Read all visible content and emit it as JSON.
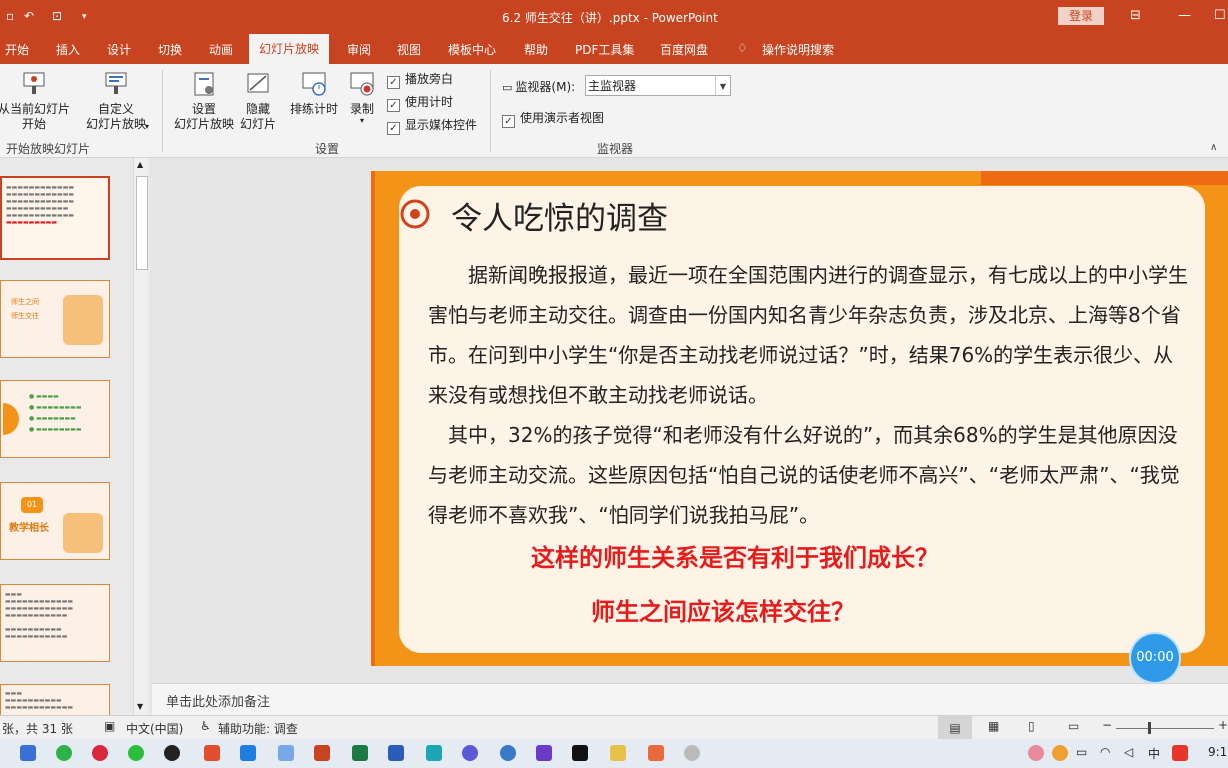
{
  "window": {
    "title": "6.2 师生交往（讲）.pptx  -  PowerPoint",
    "login": "登录"
  },
  "menu": [
    "开始",
    "插入",
    "设计",
    "切换",
    "动画",
    "幻灯片放映",
    "审阅",
    "视图",
    "模板中心",
    "帮助",
    "PDF工具集",
    "百度网盘",
    "操作说明搜索"
  ],
  "menu_active": "幻灯片放映",
  "ribbon": {
    "from_current": "从当前幻灯片\n开始",
    "custom": "自定义\n幻灯片放映",
    "group_start": "开始放映幻灯片",
    "setup": "设置\n幻灯片放映",
    "hide": "隐藏\n幻灯片",
    "rehearse": "排练计时",
    "record": "录制",
    "chk_narration": "播放旁白",
    "chk_timing": "使用计时",
    "chk_media": "显示媒体控件",
    "group_setup": "设置",
    "monitor_label": "监视器(M):",
    "monitor_value": "主监视器",
    "presenter_view": "使用演示者视图",
    "group_monitor": "监视器"
  },
  "thumbnails": {
    "t2_a": "师生之间",
    "t2_b": "师生交往",
    "t4_num": "01",
    "t4_label": "教学相长"
  },
  "slide": {
    "title": "令人吃惊的调查",
    "para1": "据新闻晚报报道，最近一项在全国范围内进行的调查显示，有七成以上的中小学生害怕与老师主动交往。调查由一份国内知名青少年杂志负责，涉及北京、上海等8个省市。在问到中小学生“你是否主动找老师说过话？”时，结果76%的学生表示很少、从来没有或想找但不敢主动找老师说话。",
    "para2": "其中，32%的孩子觉得“和老师没有什么好说的”，而其余68%的学生是其他原因没与老师主动交流。这些原因包括“怕自己说的话使老师不高兴”、“老师太严肃”、“我觉得老师不喜欢我”、“怕同学们说我拍马屁”。",
    "question1": "这样的师生关系是否有利于我们成长？",
    "question2": "师生之间应该怎样交往？"
  },
  "timer": "00:00",
  "notes_placeholder": "单击此处添加备注",
  "status": {
    "slide_info": "张，共 31 张",
    "language": "中文(中国)",
    "accessibility": "辅助功能: 调查"
  },
  "taskbar": {
    "ime": "中",
    "clock": "9:1"
  }
}
